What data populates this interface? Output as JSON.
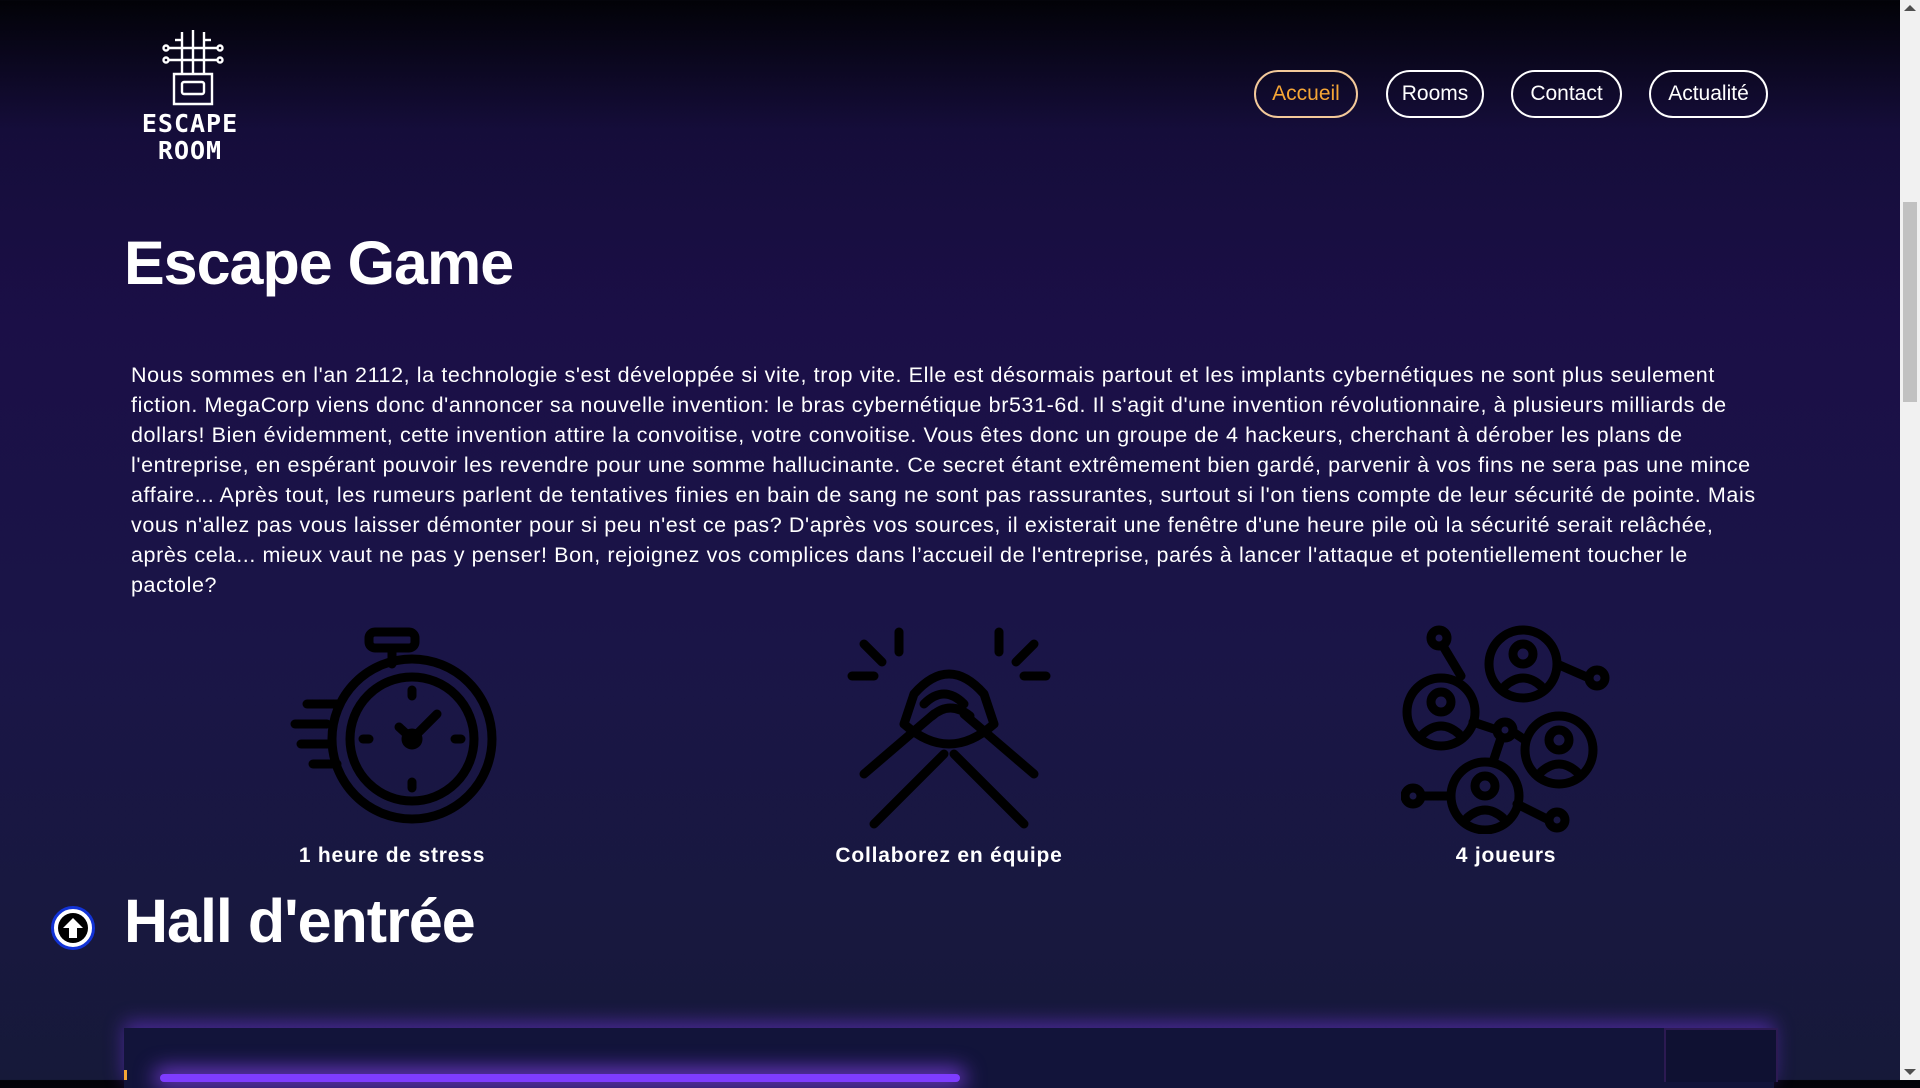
{
  "header": {
    "logo": {
      "line1": "ESCAPE",
      "line2": "ROOM",
      "icon": "circuit-tower-icon"
    },
    "nav": [
      {
        "label": "Accueil",
        "active": true
      },
      {
        "label": "Rooms",
        "active": false
      },
      {
        "label": "Contact",
        "active": false
      },
      {
        "label": "Actualité",
        "active": false
      }
    ]
  },
  "main": {
    "title": "Escape Game",
    "intro": "Nous sommes en l'an 2112, la technologie s'est développée si vite, trop vite. Elle est désormais partout et les implants cybernétiques ne sont plus seulement fiction. MegaCorp viens donc d'annoncer sa nouvelle invention: le bras cybernétique br531-6d. Il s'agit d'une invention révolutionnaire, à plusieurs milliards de dollars! Bien évidemment, cette invention attire la convoitise, votre convoitise. Vous êtes donc un groupe de 4 hackeurs, cherchant à dérober les plans de l'entreprise, en espérant pouvoir les revendre pour une somme hallucinante. Ce secret étant extrêmement bien gardé, parvenir à vos fins ne sera pas une mince affaire... Après tout, les rumeurs parlent de tentatives finies en bain de sang ne sont pas rassurantes, surtout si l'on tiens compte de leur sécurité de pointe. Mais vous n'allez pas vous laisser démonter pour si peu n'est ce pas? D'après vos sources, il existerait une fenêtre d'une heure pile où la sécurité serait relâchée, après cela... mieux vaut ne pas y penser! Bon, rejoignez vos complices dans l’accueil de l'entreprise, parés à lancer l'attaque et potentiellement toucher le pactole?",
    "features": [
      {
        "icon": "stopwatch-icon",
        "label": "1 heure de stress"
      },
      {
        "icon": "handshake-icon",
        "label": "Collaborez en équipe"
      },
      {
        "icon": "team-network-icon",
        "label": "4 joueurs"
      }
    ],
    "section_title": "Hall d'entrée"
  },
  "scroll_top": {
    "icon": "arrow-up-icon"
  },
  "colors": {
    "accent": "#f6a635",
    "active_border": "#f3c99a",
    "background": "#1b0f47",
    "scroll_button_ring": "#1233d6",
    "panel_glow": "#7e3cff"
  }
}
